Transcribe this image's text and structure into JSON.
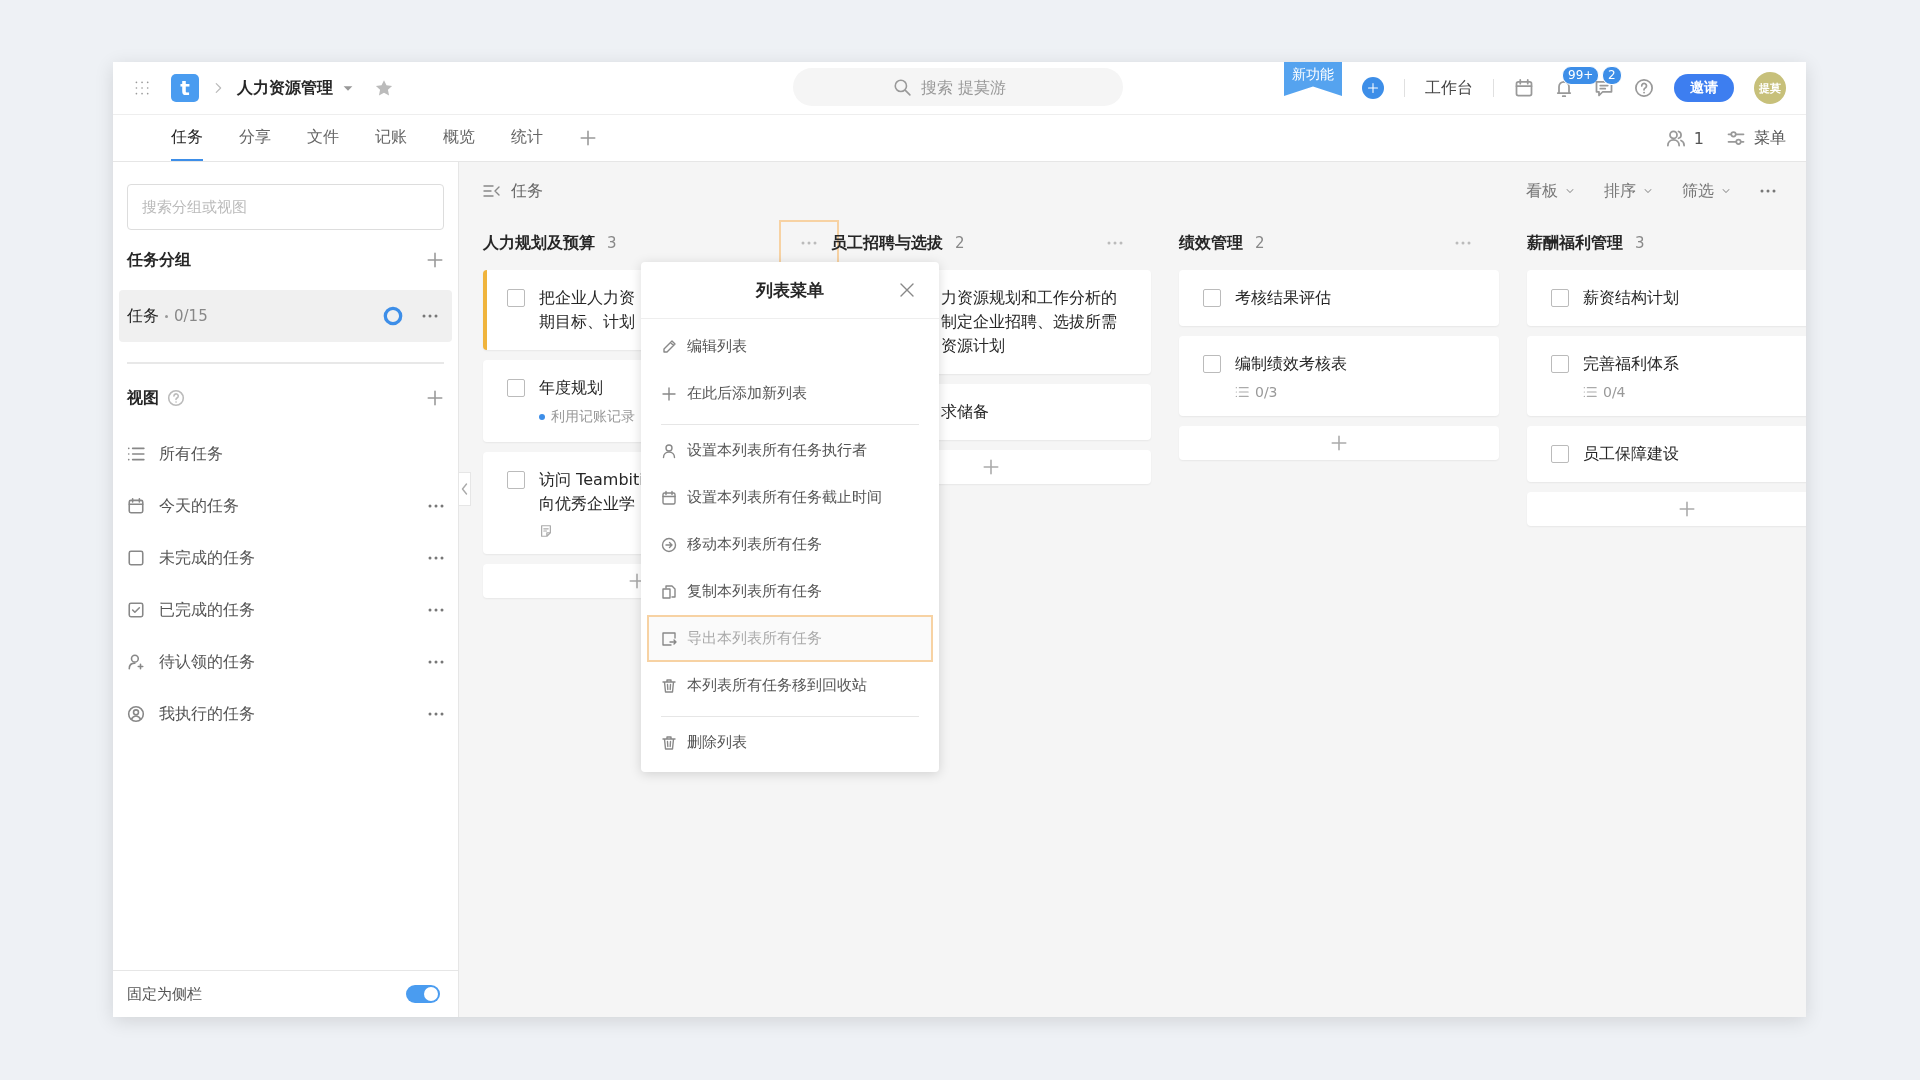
{
  "topbar": {
    "logo": "t",
    "project": "人力资源管理",
    "search": {
      "placeholder": "搜索 提莫游"
    },
    "new_badge": "新功能",
    "workbench": "工作台",
    "notifications": "99+",
    "messages": "2",
    "invite": "邀请",
    "avatar": "提莫"
  },
  "tabs": [
    {
      "label": "任务",
      "selected": true
    },
    {
      "label": "分享",
      "selected": false
    },
    {
      "label": "文件",
      "selected": false
    },
    {
      "label": "记账",
      "selected": false
    },
    {
      "label": "概览",
      "selected": false
    },
    {
      "label": "统计",
      "selected": false
    }
  ],
  "members": "1",
  "menu_label": "菜单",
  "sidebar": {
    "search": {
      "placeholder": "搜索分组或视图"
    },
    "groups_title": "任务分组",
    "groups": [
      {
        "label": "任务",
        "count": "0/15",
        "selected": true
      }
    ],
    "views_title": "视图",
    "views": [
      {
        "kind": "all",
        "label": "所有任务",
        "more": false
      },
      {
        "kind": "today",
        "label": "今天的任务",
        "more": true
      },
      {
        "kind": "open",
        "label": "未完成的任务",
        "more": true
      },
      {
        "kind": "done",
        "label": "已完成的任务",
        "more": true
      },
      {
        "kind": "unclaimed",
        "label": "待认领的任务",
        "more": true
      },
      {
        "kind": "mine",
        "label": "我执行的任务",
        "more": true
      }
    ],
    "pin_label": "固定为侧栏",
    "pinned": true
  },
  "board": {
    "title": "任务",
    "controls": [
      "看板",
      "排序",
      "筛选"
    ],
    "columns": [
      {
        "title": "人力规划及预算",
        "count": "3",
        "kind": "covered_right",
        "more_highlighted": true,
        "more_visible": true,
        "cards": [
          {
            "lines": [
              "把企业人力资",
              "期目标、计划"
            ],
            "accent": true
          },
          {
            "lines": [
              "年度规划"
            ],
            "note": "利用记账记录",
            "accent": false
          },
          {
            "lines": [
              "访问 Teambiti",
              "向优秀企业学"
            ],
            "attachment": true,
            "accent": false
          }
        ]
      },
      {
        "title": "员工招聘与选拔",
        "count": "2",
        "kind": "covered_left",
        "more_highlighted": false,
        "more_visible": true,
        "cards": [
          {
            "lines": [
              "力资源规划和工作分析的",
              "制定企业招聘、选拔所需",
              "资源计划"
            ]
          },
          {
            "lines": [
              "求储备"
            ]
          }
        ]
      },
      {
        "title": "绩效管理",
        "count": "2",
        "kind": "plain",
        "more_highlighted": false,
        "more_visible": true,
        "cards": [
          {
            "lines": [
              "考核结果评估"
            ],
            "accent": false
          },
          {
            "lines": [
              "编制绩效考核表"
            ],
            "subtasks": "0/3",
            "accent": false
          }
        ]
      },
      {
        "title": "薪酬福利管理",
        "count": "3",
        "kind": "plain",
        "more_visible": false,
        "cards": [
          {
            "lines": [
              "薪资结构计划"
            ],
            "accent": false
          },
          {
            "lines": [
              "完善福利体系"
            ],
            "subtasks": "0/4",
            "accent": false
          },
          {
            "lines": [
              "员工保障建设"
            ],
            "accent": false
          }
        ]
      }
    ]
  },
  "list_menu": {
    "title": "列表菜单",
    "items": [
      {
        "kind": "edit",
        "label": "编辑列表",
        "highlighted": false,
        "divider_after": false
      },
      {
        "kind": "add",
        "label": "在此后添加新列表",
        "highlighted": false,
        "divider_after": true
      },
      {
        "kind": "assignee",
        "label": "设置本列表所有任务执行者",
        "highlighted": false,
        "divider_after": false
      },
      {
        "kind": "due",
        "label": "设置本列表所有任务截止时间",
        "highlighted": false,
        "divider_after": false
      },
      {
        "kind": "move",
        "label": "移动本列表所有任务",
        "highlighted": false,
        "divider_after": false
      },
      {
        "kind": "copy",
        "label": "复制本列表所有任务",
        "highlighted": false,
        "divider_after": false
      },
      {
        "kind": "export",
        "label": "导出本列表所有任务",
        "highlighted": true,
        "divider_after": false
      },
      {
        "kind": "trash",
        "label": "本列表所有任务移到回收站",
        "highlighted": false,
        "divider_after": true
      },
      {
        "kind": "delete",
        "label": "删除列表",
        "highlighted": false,
        "divider_after": false
      }
    ]
  }
}
